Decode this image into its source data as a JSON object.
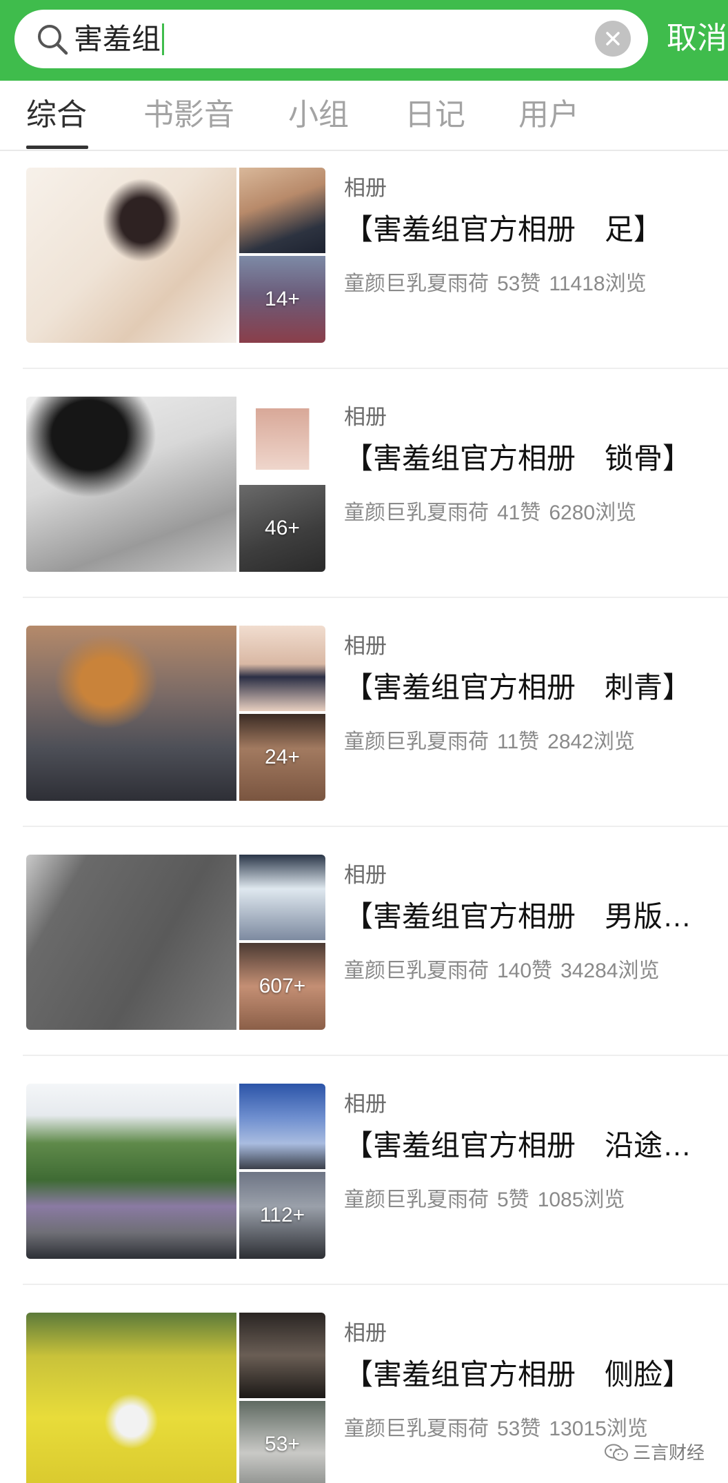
{
  "header": {
    "search_value": "害羞组",
    "cancel_label": "取消",
    "accent_color": "#3fbc4c",
    "search_icon": "search-icon",
    "clear_icon": "clear-icon"
  },
  "tabs": [
    {
      "label": "综合",
      "active": true
    },
    {
      "label": "书影音",
      "active": false
    },
    {
      "label": "小组",
      "active": false
    },
    {
      "label": "日记",
      "active": false
    },
    {
      "label": "用户",
      "active": false
    }
  ],
  "results": [
    {
      "type_label": "相册",
      "title": "【害羞组官方相册　足】",
      "author": "童颜巨乳夏雨荷",
      "likes": "53赞",
      "views": "11418浏览",
      "photo_count": "14+"
    },
    {
      "type_label": "相册",
      "title": "【害羞组官方相册　锁骨】",
      "author": "童颜巨乳夏雨荷",
      "likes": "41赞",
      "views": "6280浏览",
      "photo_count": "46+"
    },
    {
      "type_label": "相册",
      "title": "【害羞组官方相册　刺青】",
      "author": "童颜巨乳夏雨荷",
      "likes": "11赞",
      "views": "2842浏览",
      "photo_count": "24+"
    },
    {
      "type_label": "相册",
      "title": "【害羞组官方相册　男版…",
      "author": "童颜巨乳夏雨荷",
      "likes": "140赞",
      "views": "34284浏览",
      "photo_count": "607+"
    },
    {
      "type_label": "相册",
      "title": "【害羞组官方相册　沿途…",
      "author": "童颜巨乳夏雨荷",
      "likes": "5赞",
      "views": "1085浏览",
      "photo_count": "112+"
    },
    {
      "type_label": "相册",
      "title": "【害羞组官方相册　侧脸】",
      "author": "童颜巨乳夏雨荷",
      "likes": "53赞",
      "views": "13015浏览",
      "photo_count": "53+"
    }
  ],
  "watermark": {
    "text": "三言财经",
    "icon": "wechat-icon"
  }
}
